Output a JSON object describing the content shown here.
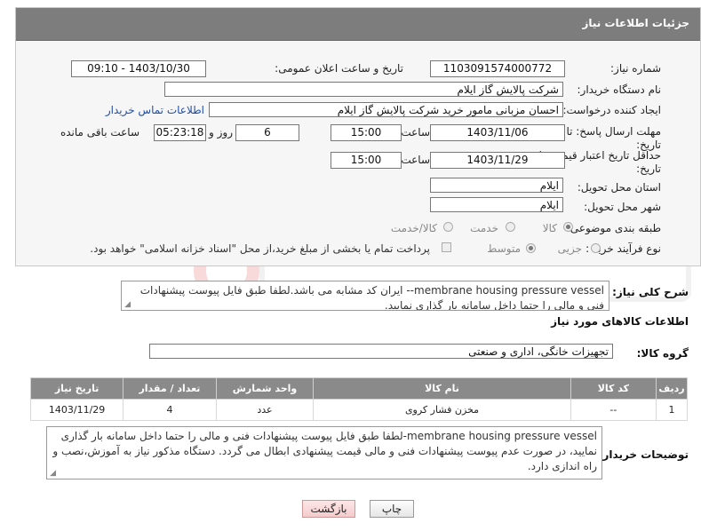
{
  "header": {
    "title": "جزئیات اطلاعات نیاز"
  },
  "fields": {
    "need_number_label": "شماره نیاز:",
    "need_number": "1103091574000772",
    "announce_label": "تاریخ و ساعت اعلان عمومی:",
    "announce_value": "1403/10/30 - 09:10",
    "buyer_org_label": "نام دستگاه خریدار:",
    "buyer_org": "شرکت پالایش گاز ایلام",
    "creator_label": "ایجاد کننده درخواست:",
    "creator": "احسان مزبانی مامور خرید شرکت پالایش گاز ایلام",
    "contact_link": "اطلاعات تماس خریدار",
    "deadline_label": "مهلت ارسال پاسخ: تا تاریخ:",
    "deadline_date": "1403/11/06",
    "time_label": "ساعت",
    "deadline_time": "15:00",
    "days_value": "6",
    "days_and_label": "روز و",
    "remaining_value": "05:23:18",
    "remaining_label": "ساعت باقی مانده",
    "price_validity_label": "حداقل تاریخ اعتبار قیمت: تا تاریخ:",
    "price_validity_date": "1403/11/29",
    "price_validity_time": "15:00",
    "province_label": "استان محل تحویل:",
    "province": "ایلام",
    "city_label": "شهر محل تحویل:",
    "city": "ایلام",
    "category_label": "طبقه بندی موضوعی:",
    "category_options": [
      "کالا",
      "خدمت",
      "کالا/خدمت"
    ],
    "process_label": "نوع فرآیند خرید :",
    "process_options": [
      "جزیی",
      "متوسط"
    ],
    "payment_note": "پرداخت تمام یا بخشی از مبلغ خرید،از محل \"اسناد خزانه اسلامی\" خواهد بود."
  },
  "description": {
    "label": "شرح کلی نیاز:",
    "text": "membrane housing pressure vessel-- ایران کد مشابه می باشد.لطفا طبق فایل پیوست پیشنهادات فنی و مالی را حتما داخل سامانه بار گذاری نمایید."
  },
  "goods_info": {
    "title": "اطلاعات کالاهای مورد نیاز",
    "group_label": "گروه کالا:",
    "group_value": "تجهیزات خانگی، اداری و صنعتی"
  },
  "table": {
    "headers": [
      "ردیف",
      "کد کالا",
      "نام کالا",
      "واحد شمارش",
      "تعداد / مقدار",
      "تاریخ نیاز"
    ],
    "rows": [
      [
        "1",
        "--",
        "مخزن فشار کروی",
        "عدد",
        "4",
        "1403/11/29"
      ]
    ]
  },
  "buyer_notes": {
    "label": "توضیحات خریدار:",
    "text": "membrane housing pressure vessel-لطفا طبق فایل پیوست پیشنهادات فنی و مالی را حتما داخل سامانه بار گذاری نمایید، در صورت عدم پیوست پیشنهادات فنی و مالی قیمت پیشنهادی ابطال می گردد. دستگاه مذکور نیاز به آموزش،نصب و راه اندازی دارد."
  },
  "buttons": {
    "print": "چاپ",
    "back": "بازگشت"
  },
  "colors": {
    "header_bg": "#7d7d7d",
    "table_header_bg": "#8a8a8a",
    "link": "#1f4fa6",
    "back_button_bg": "#f3cccc"
  }
}
